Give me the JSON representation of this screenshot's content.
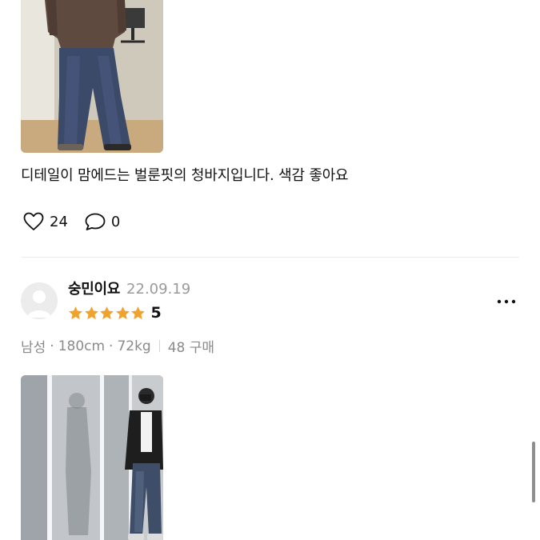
{
  "reviews": [
    {
      "text": "디테일이 맘에드는 벌룬핏의 청바지입니다. 색감 좋아요",
      "likes": "24",
      "comments": "0",
      "photo_icon": "review-photo"
    },
    {
      "username": "숭민이요",
      "date": "22.09.19",
      "rating": "5",
      "stars": 5,
      "gender": "남성",
      "height": "180cm",
      "weight": "72kg",
      "purchases": "48 구매",
      "photo_icon": "review-photo"
    }
  ],
  "icons": {
    "like": "heart-outline-icon",
    "comment": "speech-bubble-icon",
    "more": "more-dots-icon",
    "star": "star-icon",
    "avatar": "default-avatar"
  },
  "colors": {
    "star": "#F0A22E",
    "date": "#9A9A9A",
    "meta": "#8A8A8A",
    "avatar_bg": "#ECECEC",
    "divider": "#ECECEC"
  }
}
